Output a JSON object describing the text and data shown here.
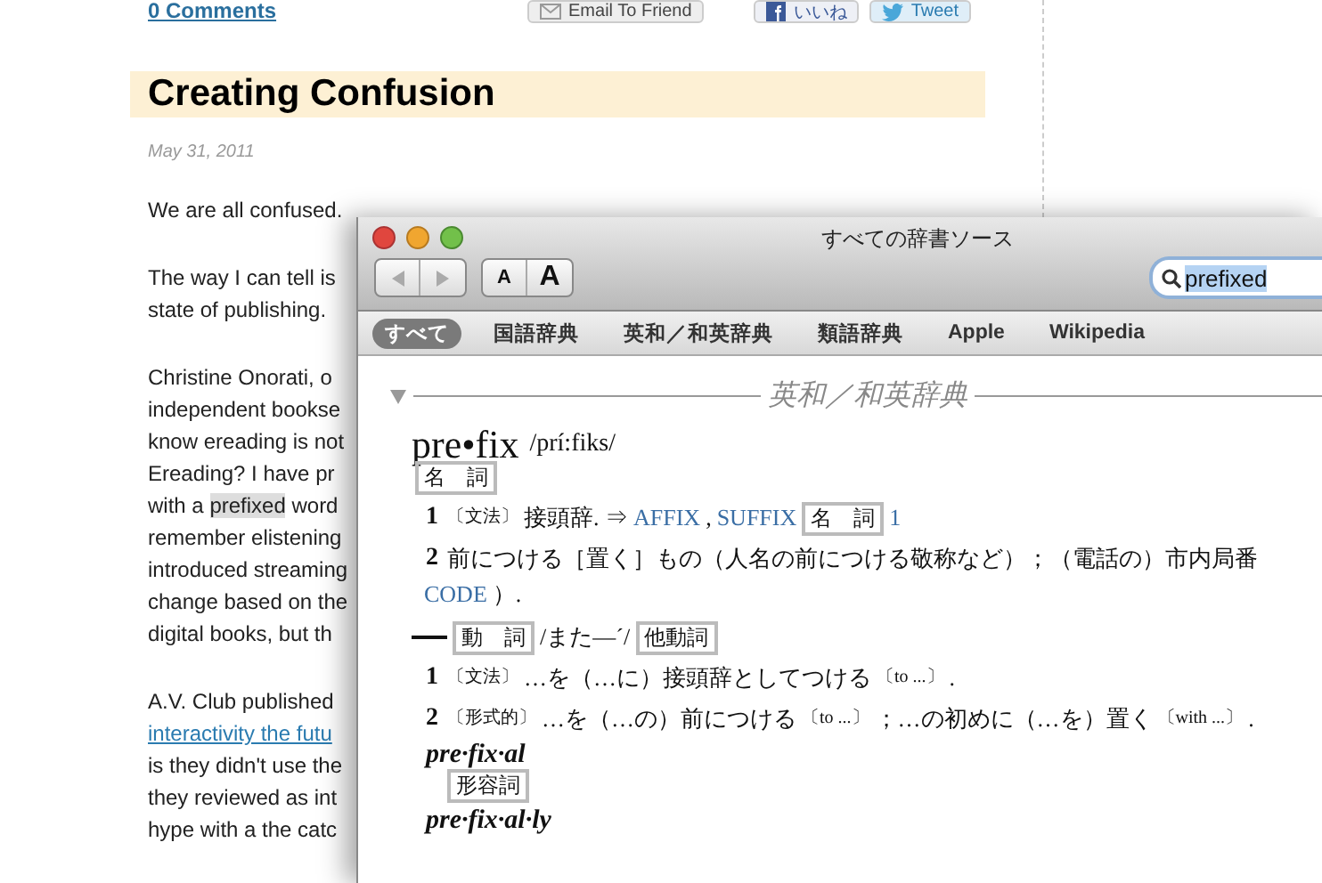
{
  "post_actions": {
    "comments_link": "0 Comments",
    "email_button": "Email To Friend",
    "like_button": "いいね",
    "tweet_button": "Tweet"
  },
  "post": {
    "title": "Creating Confusion",
    "date": "May 31, 2011",
    "paragraphs": [
      {
        "lines": [
          [
            {
              "kind": "plain",
              "text": "We are all confused."
            }
          ]
        ]
      },
      {
        "lines": [
          [
            {
              "kind": "plain",
              "text": "The way I can tell is"
            }
          ],
          [
            {
              "kind": "plain",
              "text": "state of publishing."
            }
          ]
        ]
      },
      {
        "lines": [
          [
            {
              "kind": "plain",
              "text": "Christine Onorati, o"
            }
          ],
          [
            {
              "kind": "plain",
              "text": "independent bookse"
            }
          ],
          [
            {
              "kind": "plain",
              "text": "know ereading is not"
            }
          ],
          [
            {
              "kind": "plain",
              "text": "Ereading? I have pr"
            }
          ],
          [
            {
              "kind": "plain",
              "text": "with a "
            },
            {
              "kind": "highlight",
              "text": "prefixed"
            },
            {
              "kind": "plain",
              "text": " word"
            }
          ],
          [
            {
              "kind": "plain",
              "text": "remember elistening"
            }
          ],
          [
            {
              "kind": "plain",
              "text": "introduced streaming"
            }
          ],
          [
            {
              "kind": "plain",
              "text": "change based on the"
            }
          ],
          [
            {
              "kind": "plain",
              "text": "digital books, but th"
            }
          ]
        ]
      },
      {
        "lines": [
          [
            {
              "kind": "plain",
              "text": "A.V. Club published"
            }
          ],
          [
            {
              "kind": "link",
              "text": "interactivity the futu"
            }
          ],
          [
            {
              "kind": "plain",
              "text": "is they didn't use the"
            }
          ],
          [
            {
              "kind": "plain",
              "text": "they reviewed as int"
            }
          ],
          [
            {
              "kind": "plain",
              "text": "hype with a the catc"
            }
          ]
        ]
      }
    ]
  },
  "dictionary": {
    "window": {
      "title": "すべての辞書ソース"
    },
    "font_buttons": [
      {
        "kind": "smaller",
        "label": "A"
      },
      {
        "kind": "larger",
        "label": "A"
      }
    ],
    "search": {
      "value": "prefixed"
    },
    "sources": [
      {
        "label": "すべて",
        "selected": true
      },
      {
        "label": "国語辞典",
        "selected": false
      },
      {
        "label": "英和／和英辞典",
        "selected": false
      },
      {
        "label": "類語辞典",
        "selected": false
      },
      {
        "label": "Apple",
        "selected": false
      },
      {
        "label": "Wikipedia",
        "selected": false
      }
    ],
    "section": {
      "title": "英和／和英辞典",
      "expanded": true
    },
    "entry_lines": [
      {
        "kind": "head",
        "segments": [
          {
            "kind": "headword",
            "text": "pre•fix"
          },
          {
            "kind": "pron",
            "text": "/prí:fiks/"
          }
        ]
      },
      {
        "kind": "tagline",
        "segments": [
          {
            "kind": "tag",
            "text": "名　詞"
          }
        ]
      },
      {
        "kind": "sense",
        "segments": [
          {
            "kind": "num",
            "text": "1"
          },
          {
            "kind": "label",
            "text": "〔文法〕"
          },
          {
            "kind": "text",
            "text": "接頭辞. ⇒"
          },
          {
            "kind": "link",
            "text": "AFFIX"
          },
          {
            "kind": "text",
            "text": ", "
          },
          {
            "kind": "link",
            "text": "SUFFIX"
          },
          {
            "kind": "tag",
            "text": "名　詞"
          },
          {
            "kind": "link",
            "text": "1"
          }
        ]
      },
      {
        "kind": "sense",
        "segments": [
          {
            "kind": "num",
            "text": "2"
          },
          {
            "kind": "text",
            "text": "前につける［置く］もの（人名の前につける敬称など）；（電話の）市内局番"
          }
        ]
      },
      {
        "kind": "cont",
        "segments": [
          {
            "kind": "link",
            "text": "CODE"
          },
          {
            "kind": "text",
            "text": "）."
          }
        ]
      },
      {
        "kind": "verbhead",
        "segments": [
          {
            "kind": "tag",
            "text": "動　詞"
          },
          {
            "kind": "text",
            "text": "/また―ˊ/"
          },
          {
            "kind": "tag",
            "text": "他動詞"
          }
        ]
      },
      {
        "kind": "sense",
        "segments": [
          {
            "kind": "num",
            "text": "1"
          },
          {
            "kind": "label",
            "text": "〔文法〕"
          },
          {
            "kind": "text",
            "text": "…を（…に）接頭辞としてつける"
          },
          {
            "kind": "label",
            "text": "〔to ...〕"
          },
          {
            "kind": "text",
            "text": "."
          }
        ]
      },
      {
        "kind": "sense",
        "segments": [
          {
            "kind": "num",
            "text": "2"
          },
          {
            "kind": "label",
            "text": "〔形式的〕"
          },
          {
            "kind": "text",
            "text": "…を（…の）前につける"
          },
          {
            "kind": "label",
            "text": "〔to ...〕"
          },
          {
            "kind": "text",
            "text": "；…の初めに（…を）置く"
          },
          {
            "kind": "label",
            "text": "〔with ...〕"
          },
          {
            "kind": "text",
            "text": "."
          }
        ]
      },
      {
        "kind": "derived",
        "segments": [
          {
            "kind": "derived",
            "text": "pre·fix·al"
          }
        ]
      },
      {
        "kind": "derivedtag",
        "segments": [
          {
            "kind": "tag",
            "text": "形容詞"
          }
        ]
      },
      {
        "kind": "derived",
        "segments": [
          {
            "kind": "derived",
            "text": "pre·fix·al·ly"
          }
        ]
      }
    ]
  }
}
